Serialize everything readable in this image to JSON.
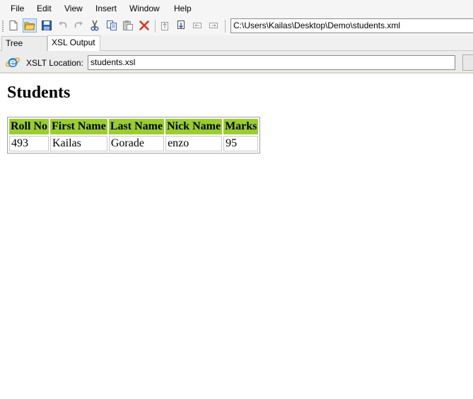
{
  "menu": [
    "File",
    "Edit",
    "View",
    "Insert",
    "Window",
    "Help"
  ],
  "toolbar": {
    "path_value": "C:\\Users\\Kailas\\Desktop\\Demo\\students.xml"
  },
  "tabs": [
    {
      "label": "Tree View",
      "active": false
    },
    {
      "label": "XSL Output",
      "active": true
    }
  ],
  "xslt": {
    "label": "XSLT Location:",
    "value": "students.xsl"
  },
  "output": {
    "title": "Students",
    "columns": [
      "Roll No",
      "First Name",
      "Last Name",
      "Nick Name",
      "Marks"
    ],
    "rows": [
      [
        "493",
        "Kailas",
        "Gorade",
        "enzo",
        "95"
      ]
    ]
  },
  "colors": {
    "header_bg": "#9acd32"
  }
}
